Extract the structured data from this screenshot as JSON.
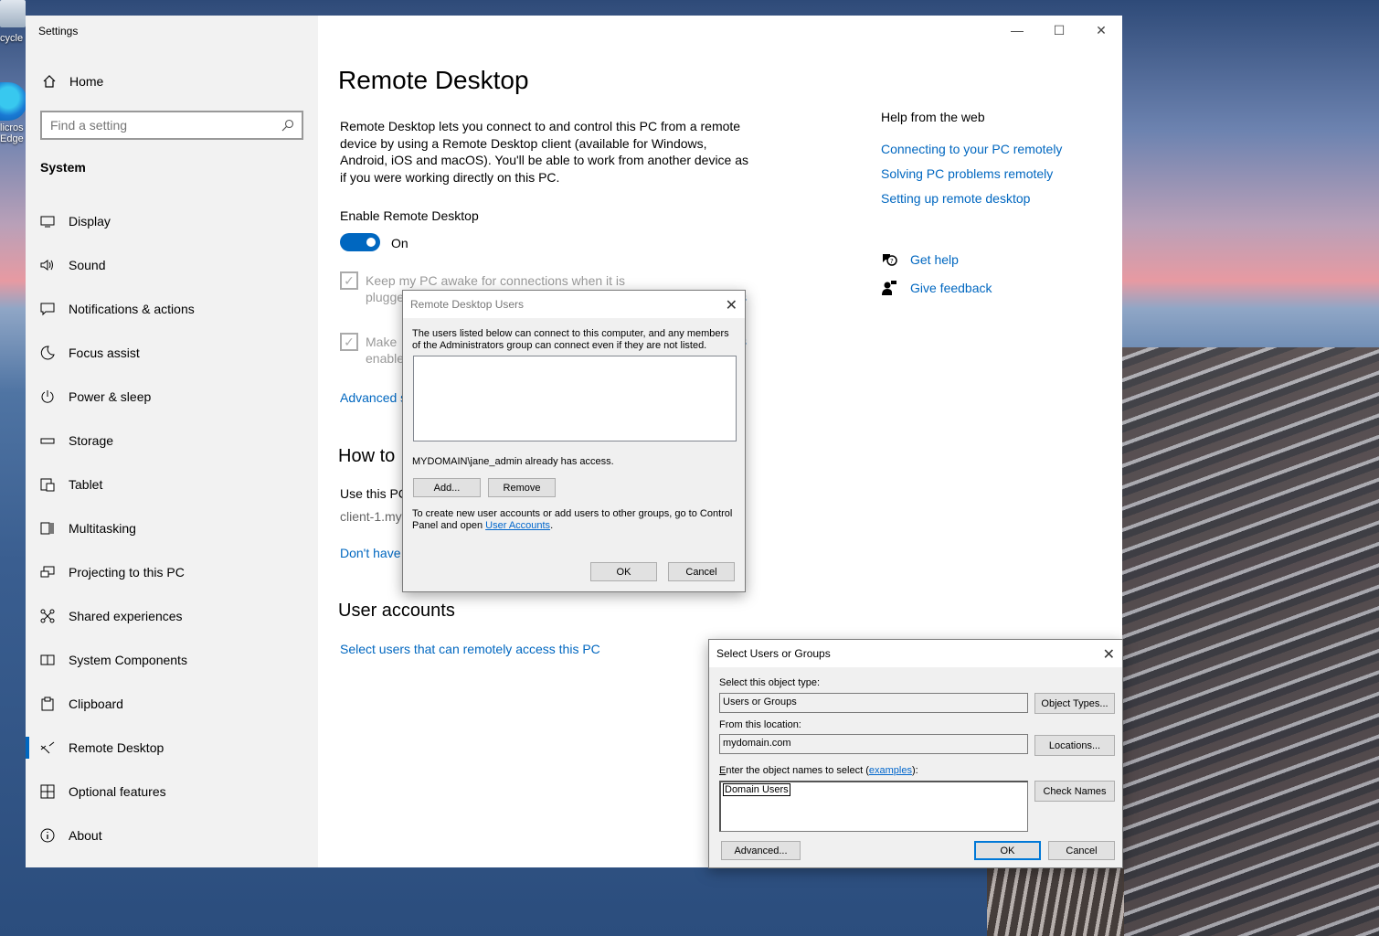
{
  "desktop": {
    "recycle_label": "cycle",
    "edge_label_1": "licros",
    "edge_label_2": "Edge"
  },
  "window": {
    "title": "Settings",
    "min_glyph": "—",
    "max_glyph": "☐",
    "close_glyph": "✕"
  },
  "sidebar": {
    "home": "Home",
    "search_placeholder": "Find a setting",
    "section": "System",
    "items": [
      {
        "label": "Display",
        "icon": "monitor-icon"
      },
      {
        "label": "Sound",
        "icon": "speaker-icon"
      },
      {
        "label": "Notifications & actions",
        "icon": "notification-icon"
      },
      {
        "label": "Focus assist",
        "icon": "moon-icon"
      },
      {
        "label": "Power & sleep",
        "icon": "power-icon"
      },
      {
        "label": "Storage",
        "icon": "storage-icon"
      },
      {
        "label": "Tablet",
        "icon": "tablet-icon"
      },
      {
        "label": "Multitasking",
        "icon": "multitasking-icon"
      },
      {
        "label": "Projecting to this PC",
        "icon": "projecting-icon"
      },
      {
        "label": "Shared experiences",
        "icon": "shared-icon"
      },
      {
        "label": "System Components",
        "icon": "components-icon"
      },
      {
        "label": "Clipboard",
        "icon": "clipboard-icon"
      },
      {
        "label": "Remote Desktop",
        "icon": "remote-desktop-icon",
        "active": true
      },
      {
        "label": "Optional features",
        "icon": "optional-features-icon"
      },
      {
        "label": "About",
        "icon": "info-icon"
      }
    ]
  },
  "main": {
    "title": "Remote Desktop",
    "description": "Remote Desktop lets you connect to and control this PC from a remote device by using a Remote Desktop client (available for Windows, Android, iOS and macOS). You'll be able to work from another device as if you were working directly on this PC.",
    "enable_label": "Enable Remote Desktop",
    "toggle_state": "On",
    "keep_awake_1": "Keep my PC awake for connections when it is",
    "keep_awake_2": "plugge",
    "make_1": "Make",
    "make_2": "enable",
    "settings_link_suffix": "s",
    "advanced_link": "Advanced s",
    "how_to_heading": "How to",
    "use_this_pc": "Use this PC",
    "pc_name": "client-1.my",
    "dont_have": "Don't have",
    "user_accounts_heading": "User accounts",
    "select_users_link": "Select users that can remotely access this PC"
  },
  "help": {
    "title": "Help from the web",
    "links": [
      "Connecting to your PC remotely",
      "Solving PC problems remotely",
      "Setting up remote desktop"
    ],
    "get_help": "Get help",
    "give_feedback": "Give feedback"
  },
  "rdu_dialog": {
    "title": "Remote Desktop Users",
    "intro": "The users listed below can connect to this computer, and any members of the Administrators group can connect even if they are not listed.",
    "access_note": "MYDOMAIN\\jane_admin already has access.",
    "add_button": "Add...",
    "remove_button": "Remove",
    "footer_text": "To create new user accounts or add users to other groups, go to Control Panel and open",
    "footer_link": "User Accounts",
    "footer_end": ".",
    "ok_button": "OK",
    "cancel_button": "Cancel"
  },
  "sug_dialog": {
    "title": "Select Users or Groups",
    "object_type_label": "Select this object type:",
    "object_type_value": "Users or Groups",
    "object_types_button": "Object Types...",
    "location_label": "From this location:",
    "location_value": "mydomain.com",
    "locations_button": "Locations...",
    "names_label_pre": "E",
    "names_label_mid": "nter the object names to select (",
    "names_label_link": "examples",
    "names_label_post": "):",
    "names_value": "Domain Users",
    "check_names_button": "Check Names",
    "advanced_button": "Advanced...",
    "ok_button": "OK",
    "cancel_button": "Cancel"
  },
  "colors": {
    "accent": "#0067c0",
    "sidebar_bg": "#f2f2f2",
    "dialog_bg": "#f0f0f0"
  }
}
